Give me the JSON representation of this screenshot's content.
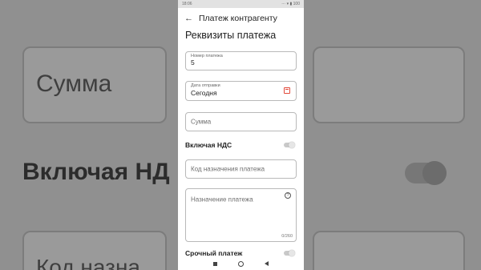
{
  "background": {
    "amount_label": "Сумма",
    "vat_label": "Включая НД",
    "code_label": "Код назна"
  },
  "statusbar": {
    "time": "18:06",
    "icons": "⋯ ▾ ▮ 100"
  },
  "appbar": {
    "back_icon": "arrow-left",
    "title": "Платеж контрагенту"
  },
  "section_title": "Реквизиты платежа",
  "fields": {
    "payment_number": {
      "label": "Номер платежа",
      "value": "5"
    },
    "send_date": {
      "label": "Дата отправки",
      "value": "Сегодня",
      "icon": "calendar-icon"
    },
    "amount": {
      "placeholder": "Сумма"
    },
    "vat_code": {
      "placeholder": "Код назначения платежа"
    },
    "purpose": {
      "placeholder": "Назначение платежа",
      "counter": "0/260",
      "icon": "info-icon"
    }
  },
  "vat_toggle": {
    "label": "Включая НДС",
    "on": false
  },
  "urgent_toggle": {
    "label": "Срочный платеж",
    "on": false
  },
  "colors": {
    "accent": "#e24a3b",
    "border": "#b9b9b9",
    "background": "#909090"
  }
}
